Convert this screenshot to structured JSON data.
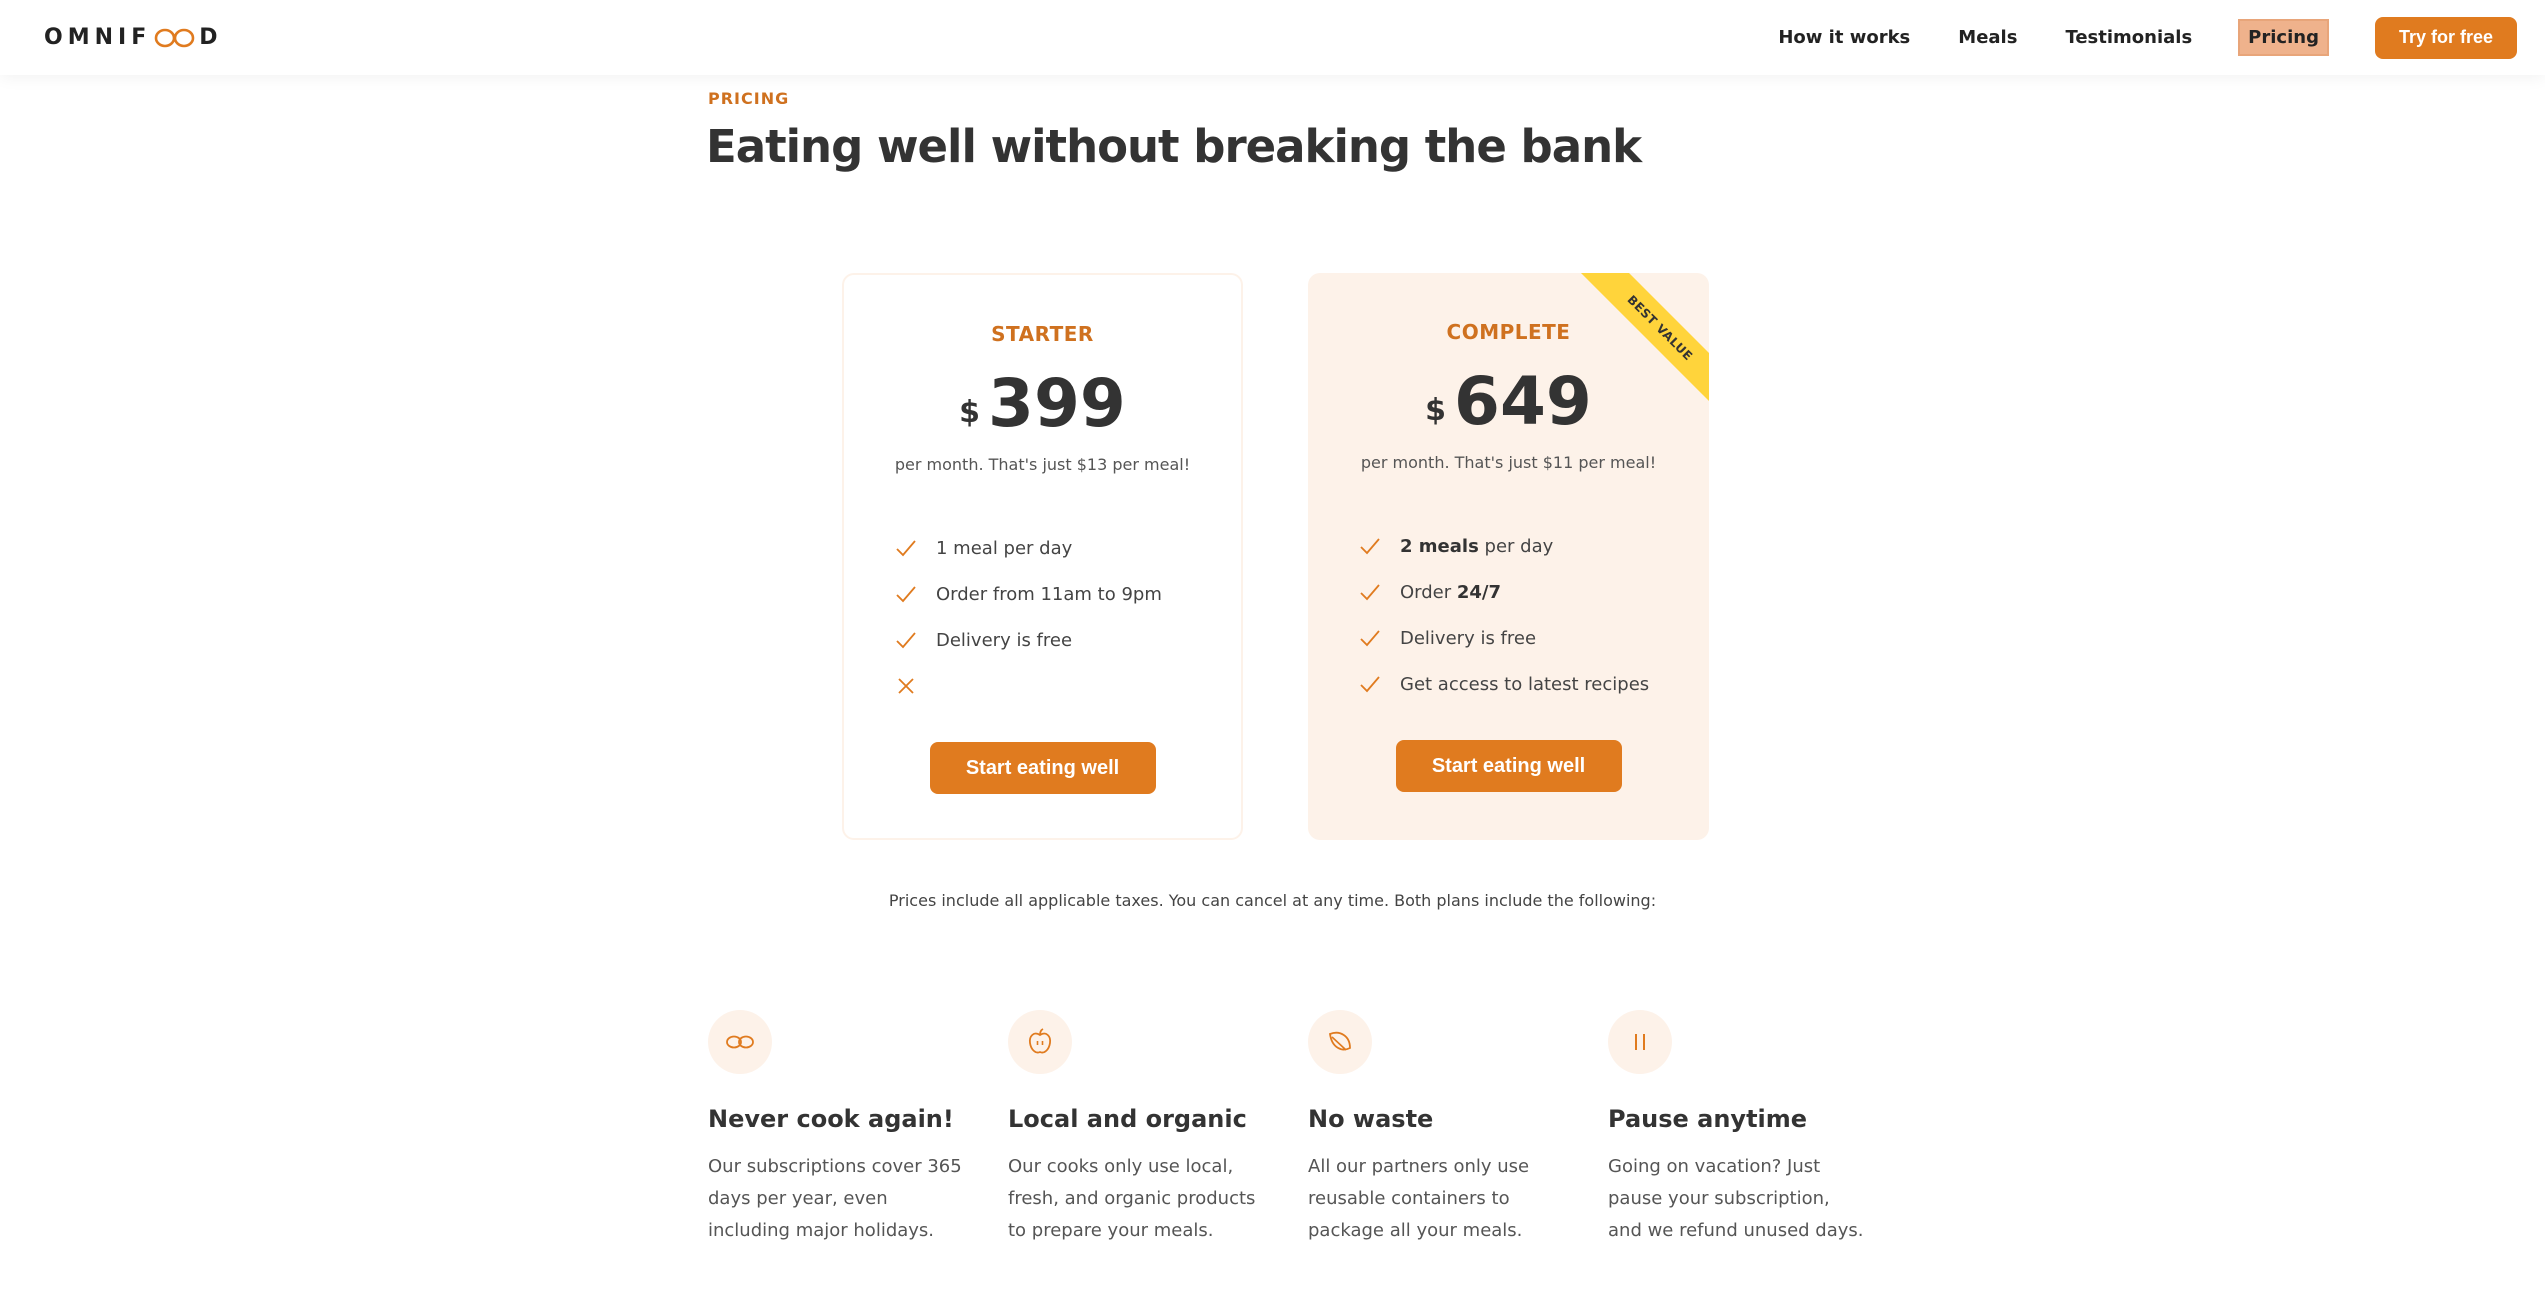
{
  "header": {
    "logo_left": "OMNIF",
    "logo_right": "D",
    "nav": [
      {
        "label": "How it works"
      },
      {
        "label": "Meals"
      },
      {
        "label": "Testimonials"
      },
      {
        "label": "Pricing"
      }
    ],
    "cta_label": "Try for free"
  },
  "section": {
    "subheading": "PRICING",
    "heading": "Eating well without breaking the bank"
  },
  "plans": [
    {
      "name": "STARTER",
      "currency": "$",
      "amount": "399",
      "text": "per month. That's just $13 per meal!",
      "features": [
        {
          "icon": "check-icon",
          "plain": "1 meal per day"
        },
        {
          "icon": "check-icon",
          "plain": "Order from 11am to 9pm"
        },
        {
          "icon": "check-icon",
          "plain": "Delivery is free"
        },
        {
          "icon": "close-icon",
          "plain": ""
        }
      ],
      "button": "Start eating well"
    },
    {
      "name": "COMPLETE",
      "currency": "$",
      "amount": "649",
      "text": "per month. That's just $11 per meal!",
      "ribbon": "BEST VALUE",
      "features": [
        {
          "icon": "check-icon",
          "bold": "2 meals",
          "plain": " per day"
        },
        {
          "icon": "check-icon",
          "plain": "Order ",
          "bold_after": "24/7"
        },
        {
          "icon": "check-icon",
          "plain": "Delivery is free"
        },
        {
          "icon": "check-icon",
          "plain": "Get access to latest recipes"
        }
      ],
      "button": "Start eating well"
    }
  ],
  "note": "Prices include all applicable taxes. You can cancel at any time. Both plans include the following:",
  "features": [
    {
      "icon": "infinity-icon",
      "title": "Never cook again!",
      "text": "Our subscriptions cover 365 days per year, even including major holidays."
    },
    {
      "icon": "apple-icon",
      "title": "Local and organic",
      "text": "Our cooks only use local, fresh, and organic products to prepare your meals."
    },
    {
      "icon": "leaf-icon",
      "title": "No waste",
      "text": "All our partners only use reusable containers to package all your meals."
    },
    {
      "icon": "pause-icon",
      "title": "Pause anytime",
      "text": "Going on vacation? Just pause your subscription, and we refund unused days."
    }
  ],
  "colors": {
    "primary": "#e07b1f",
    "primary_dark": "#cf711f",
    "tint": "#fdf2e9",
    "ribbon": "#ffd43b",
    "text": "#333333"
  }
}
